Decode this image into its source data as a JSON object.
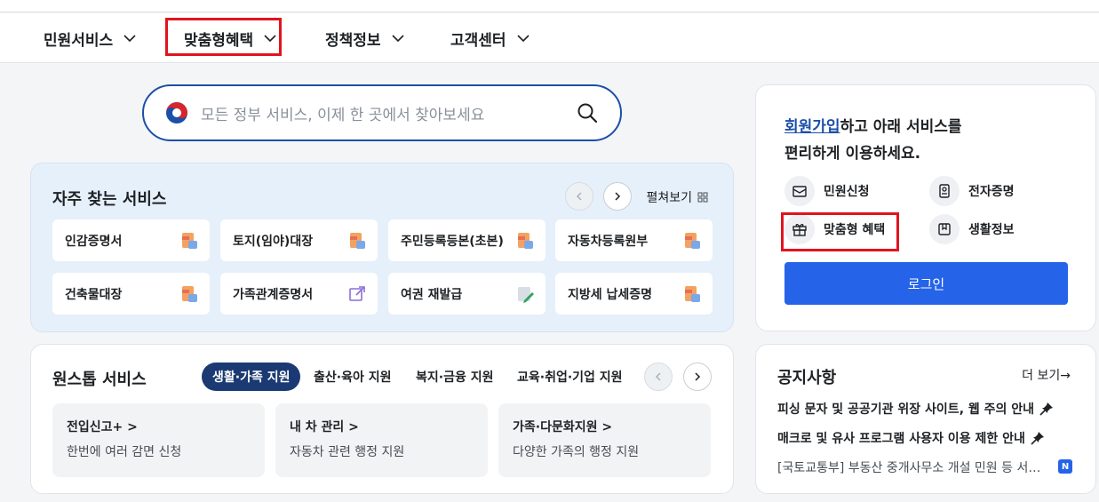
{
  "gnb": {
    "items": [
      {
        "label": "민원서비스"
      },
      {
        "label": "맞춤형혜택"
      },
      {
        "label": "정책정보"
      },
      {
        "label": "고객센터"
      }
    ]
  },
  "search": {
    "placeholder": "모든 정부 서비스, 이제 한 곳에서 찾아보세요"
  },
  "frequent": {
    "title": "자주 찾는 서비스",
    "expand_label": "펼쳐보기",
    "tiles": [
      {
        "label": "인감증명서",
        "icon": "pdf-doc-icon"
      },
      {
        "label": "토지(임야)대장",
        "icon": "pdf-doc-icon"
      },
      {
        "label": "주민등록등본(초본)",
        "icon": "pdf-doc-icon"
      },
      {
        "label": "자동차등록원부",
        "icon": "pdf-doc-icon"
      },
      {
        "label": "건축물대장",
        "icon": "pdf-doc-icon"
      },
      {
        "label": "가족관계증명서",
        "icon": "external-link-icon"
      },
      {
        "label": "여권 재발급",
        "icon": "edit-doc-icon"
      },
      {
        "label": "지방세 납세증명",
        "icon": "pdf-doc-icon"
      }
    ]
  },
  "onestop": {
    "title": "원스톱 서비스",
    "tabs": [
      "생활·가족 지원",
      "출산·육아 지원",
      "복지·금융 지원",
      "교육·취업·기업 지원"
    ],
    "cards": [
      {
        "title": "전입신고+ >",
        "desc": "한번에 여러 감면 신청"
      },
      {
        "title": "내 차 관리 >",
        "desc": "자동차 관련 행정 지원"
      },
      {
        "title": "가족·다문화지원 >",
        "desc": "다양한 가족의 행정 지원"
      }
    ]
  },
  "member": {
    "signup_link": "회원가입",
    "text_line1_rest": "하고 아래 서비스를",
    "text_line2": "편리하게 이용하세요.",
    "services": [
      {
        "label": "민원신청",
        "icon": "mail-doc-icon"
      },
      {
        "label": "전자증명",
        "icon": "id-card-icon"
      },
      {
        "label": "맞춤형 혜택",
        "icon": "gift-icon"
      },
      {
        "label": "생활정보",
        "icon": "bookmark-icon"
      }
    ],
    "login_label": "로그인"
  },
  "notice": {
    "title": "공지사항",
    "more_label": "더 보기→",
    "items": [
      "피싱 문자 및 공공기관 위장 사이트, 웹 주의 안내",
      "매크로 및 유사 프로그램 사용자 이용 제한 안내"
    ],
    "plain_item": "[국토교통부] 부동산 중개사무소 개설 민원 등 서…",
    "new_badge": "N"
  },
  "colors": {
    "primary": "#2563e9",
    "navy": "#1b3a73",
    "highlight": "#e0141e"
  }
}
